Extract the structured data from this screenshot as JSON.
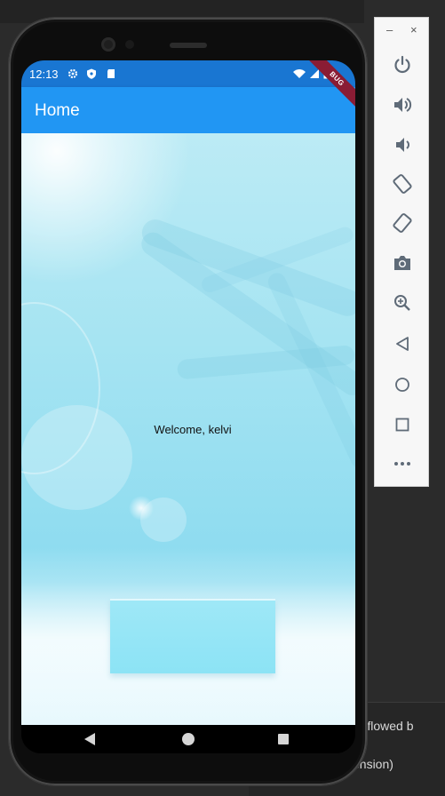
{
  "status_bar": {
    "time": "12:13"
  },
  "app_bar": {
    "title": "Home"
  },
  "debug_banner": {
    "label": "BUG"
  },
  "content": {
    "welcome_text": "Welcome, kelvi"
  },
  "emulator_panel": {
    "window_controls": [
      "–",
      "×"
    ],
    "buttons": [
      "power-icon",
      "volume-up-icon",
      "volume-down-icon",
      "rotate-left-icon",
      "rotate-right-icon",
      "camera-icon",
      "zoom-icon",
      "back-icon",
      "home-icon",
      "overview-icon",
      "more-icon"
    ]
  },
  "ide_background": {
    "line1": "loverflowed b",
    "line2": "ension)"
  },
  "colors": {
    "status_bar": "#1976d2",
    "app_bar": "#2196f3",
    "banner": "#8a1c34"
  }
}
